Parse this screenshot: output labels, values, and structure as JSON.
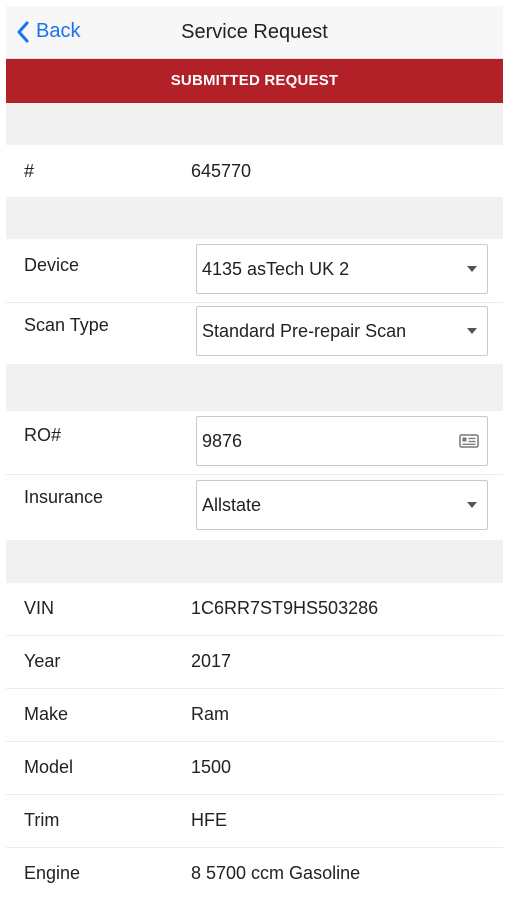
{
  "nav": {
    "back_label": "Back",
    "title": "Service Request"
  },
  "banner": {
    "text": "SUBMITTED REQUEST"
  },
  "request": {
    "number_label": "#",
    "number_value": "645770"
  },
  "device": {
    "label": "Device",
    "value": "4135 asTech UK 2"
  },
  "scan_type": {
    "label": "Scan Type",
    "value": "Standard Pre-repair Scan"
  },
  "ro": {
    "label": "RO#",
    "value": "9876"
  },
  "insurance": {
    "label": "Insurance",
    "value": "Allstate"
  },
  "vehicle": [
    {
      "label": "VIN",
      "value": "1C6RR7ST9HS503286"
    },
    {
      "label": "Year",
      "value": "2017"
    },
    {
      "label": "Make",
      "value": "Ram"
    },
    {
      "label": "Model",
      "value": "1500"
    },
    {
      "label": "Trim",
      "value": "HFE"
    },
    {
      "label": "Engine",
      "value": "8 5700 ccm Gasoline"
    }
  ],
  "colors": {
    "accent": "#1a73e8",
    "banner": "#b22028"
  },
  "icons": {
    "back": "chevron-left-icon",
    "dropdown": "caret-down-icon",
    "ro_field": "card-icon"
  }
}
